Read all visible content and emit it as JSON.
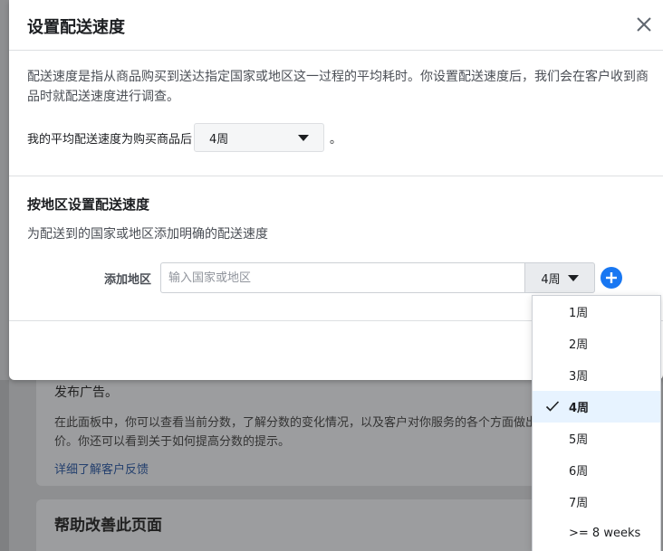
{
  "modal": {
    "title": "设置配送速度",
    "description": "配送速度是指从商品购买到送达指定国家或地区这一过程的平均耗时。你设置配送速度后，我们会在客户收到商品时就配送速度进行调查。",
    "avg_label": "我的平均配送速度为购买商品后",
    "avg_value": "4周",
    "avg_suffix": "。",
    "region_section": {
      "title": "按地区设置配送速度",
      "subtitle": "为配送到的国家或地区添加明确的配送速度",
      "add_label": "添加地区",
      "input_placeholder": "输入国家或地区",
      "week_value": "4周"
    }
  },
  "dropdown": {
    "options": [
      "1周",
      "2周",
      "3周",
      "4周",
      "5周",
      "6周",
      "7周",
      ">= 8 weeks"
    ],
    "selected": "4周"
  },
  "background": {
    "card1_line1": "发布广告。",
    "card1_text": "在此面板中，你可以查看当前分数，了解分数的变化情况，以及客户对你服务的各个方面做出的评价。你还可以看到关于如何提高分数的提示。",
    "card1_link": "详细了解客户反馈",
    "card2_title": "帮助改善此页面"
  },
  "colors": {
    "accent": "#1877f2",
    "selected_bg": "#e7f3ff",
    "overlay": "#8e8f91"
  }
}
